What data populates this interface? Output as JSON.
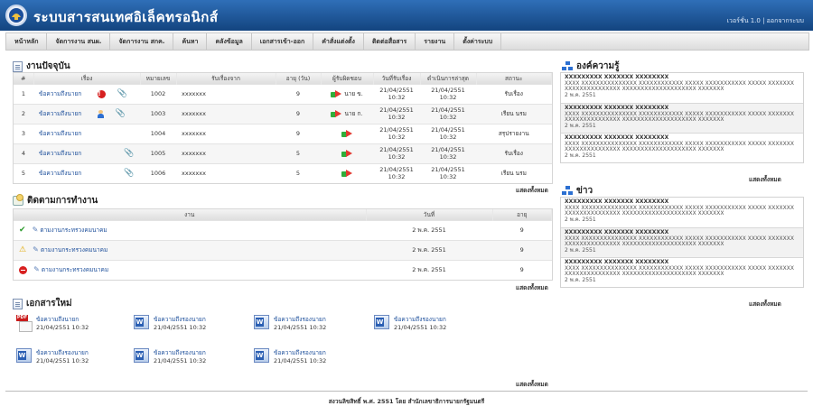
{
  "header": {
    "title": "ระบบสารสนเทศอิเล็คทรอนิกส์",
    "version_text": "เวอร์ชั่น 1.0",
    "separator": "|",
    "logout": "ออกจากระบบ"
  },
  "nav": [
    "หน้าหลัก",
    "จัดการงาน สนผ.",
    "จัดการงาน สกค.",
    "ค้นหา",
    "คลังข้อมูล",
    "เอกสารเข้า-ออก",
    "คำสั่งแต่งตั้ง",
    "ติดต่อสื่อสาร",
    "รายงาน",
    "ตั้งค่าระบบ"
  ],
  "current_work": {
    "title": "งานปัจจุบัน",
    "columns": [
      "#",
      "เรื่อง",
      "หมายเลข",
      "รับเรื่องจาก",
      "อายุ (วัน)",
      "ผู้รับผิดชอบ",
      "วันที่รับเรื่อง",
      "ดำเนินการล่าสุด",
      "สถานะ"
    ],
    "rows": [
      {
        "num": "1",
        "subject": "ข้อความถึงนายก",
        "flag": "!",
        "id": "1002",
        "from": "xxxxxxx",
        "age": "9",
        "owner": "นาย ข.",
        "received_date": "21/04/2551",
        "received_time": "10:32",
        "last_date": "21/04/2551",
        "last_time": "10:32",
        "status": "รับเรื่อง"
      },
      {
        "num": "2",
        "subject": "ข้อความถึงนายก",
        "flag": "",
        "id": "1003",
        "from": "xxxxxxx",
        "age": "9",
        "owner": "นาย ก.",
        "received_date": "21/04/2551",
        "received_time": "10:32",
        "last_date": "21/04/2551",
        "last_time": "10:32",
        "status": "เรียน นรม"
      },
      {
        "num": "3",
        "subject": "ข้อความถึงนายก",
        "flag": "",
        "id": "1004",
        "from": "xxxxxxx",
        "age": "9",
        "owner": "",
        "received_date": "21/04/2551",
        "received_time": "10:32",
        "last_date": "21/04/2551",
        "last_time": "10:32",
        "status": "สรุปรายงาน"
      },
      {
        "num": "4",
        "subject": "ข้อความถึงนายก",
        "flag": "",
        "id": "1005",
        "from": "xxxxxxx",
        "age": "5",
        "owner": "",
        "received_date": "21/04/2551",
        "received_time": "10:32",
        "last_date": "21/04/2551",
        "last_time": "10:32",
        "status": "รับเรื่อง"
      },
      {
        "num": "5",
        "subject": "ข้อความถึงนายก",
        "flag": "",
        "id": "1006",
        "from": "xxxxxxx",
        "age": "5",
        "owner": "",
        "received_date": "21/04/2551",
        "received_time": "10:32",
        "last_date": "21/04/2551",
        "last_time": "10:32",
        "status": "เรียน นรม"
      }
    ],
    "show_all": "แสดงทั้งหมด"
  },
  "followup": {
    "title": "ติดตามการทำงาน",
    "columns": [
      "งาน",
      "วันที่",
      "อายุ"
    ],
    "rows": [
      {
        "icon": "check-icon",
        "task": "ตามงานกระทรวงคมนาคม",
        "date": "2 พ.ค. 2551",
        "age": "9"
      },
      {
        "icon": "warning-icon",
        "task": "ตามงานกระทรวงคมนาคม",
        "date": "2 พ.ค. 2551",
        "age": "9"
      },
      {
        "icon": "stop-icon",
        "task": "ตามงานกระทรวงคมนาคม",
        "date": "2 พ.ค. 2551",
        "age": "9"
      }
    ],
    "show_all": "แสดงทั้งหมด"
  },
  "new_docs": {
    "title": "เอกสารใหม่",
    "items": [
      {
        "type": "pdf",
        "title": "ข้อความถึงนายก",
        "date": "21/04/2551 10:32"
      },
      {
        "type": "word",
        "title": "ข้อความถึงรองนายก",
        "date": "21/04/2551 10:32"
      },
      {
        "type": "word",
        "title": "ข้อความถึงรองนายก",
        "date": "21/04/2551 10:32"
      },
      {
        "type": "word",
        "title": "ข้อความถึงรองนายก",
        "date": "21/04/2551 10:32"
      },
      {
        "type": "word",
        "title": "ข้อความถึงรองนายก",
        "date": "21/04/2551 10:32"
      },
      {
        "type": "word",
        "title": "ข้อความถึงรองนายก",
        "date": "21/04/2551 10:32"
      },
      {
        "type": "word",
        "title": "ข้อความถึงรองนายก",
        "date": "21/04/2551 10:32"
      }
    ],
    "show_all": "แสดงทั้งหมด"
  },
  "knowledge": {
    "title": "องค์ความรู้",
    "items": [
      {
        "head": "XXXXXXXXX XXXXXXX XXXXXXXX",
        "body": "XXXX XXXXXXXXXXXXXXX XXXXXXXXXXXX XXXXX XXXXXXXXXXX XXXXX XXXXXXX XXXXXXXXXXXXXXX XXXXXXXXXXXXXXXXXXXX XXXXXXX",
        "date": "2 พ.ค. 2551"
      },
      {
        "head": "XXXXXXXXX XXXXXXX XXXXXXXX",
        "body": "XXXX XXXXXXXXXXXXXXX XXXXXXXXXXXX XXXXX XXXXXXXXXXX XXXXX XXXXXXX XXXXXXXXXXXXXXX XXXXXXXXXXXXXXXXXXXX XXXXXXX",
        "date": "2 พ.ค. 2551"
      },
      {
        "head": "XXXXXXXXX XXXXXXX XXXXXXXX",
        "body": "XXXX XXXXXXXXXXXXXXX XXXXXXXXXXXX XXXXX XXXXXXXXXXX XXXXX XXXXXXX XXXXXXXXXXXXXXX XXXXXXXXXXXXXXXXXXXX XXXXXXX",
        "date": "2 พ.ค. 2551"
      }
    ],
    "show_all": "แสดงทั้งหมด"
  },
  "news": {
    "title": "ข่าว",
    "items": [
      {
        "head": "XXXXXXXXX XXXXXXX XXXXXXXX",
        "body": "XXXX XXXXXXXXXXXXXXX XXXXXXXXXXXX XXXXX XXXXXXXXXXX XXXXX XXXXXXX XXXXXXXXXXXXXXX XXXXXXXXXXXXXXXXXXXX XXXXXXX",
        "date": "2 พ.ค. 2551"
      },
      {
        "head": "XXXXXXXXX XXXXXXX XXXXXXXX",
        "body": "XXXX XXXXXXXXXXXXXXX XXXXXXXXXXXX XXXXX XXXXXXXXXXX XXXXX XXXXXXX XXXXXXXXXXXXXXX XXXXXXXXXXXXXXXXXXXX XXXXXXX",
        "date": "2 พ.ค. 2551"
      },
      {
        "head": "XXXXXXXXX XXXXXXX XXXXXXXX",
        "body": "XXXX XXXXXXXXXXXXXXX XXXXXXXXXXXX XXXXX XXXXXXXXXXX XXXXX XXXXXXX XXXXXXXXXXXXXXX XXXXXXXXXXXXXXXXXXXX XXXXXXX",
        "date": "2 พ.ค. 2551"
      }
    ],
    "show_all": "แสดงทั้งหมด"
  },
  "footer": "สงวนลิขสิทธิ์ พ.ศ. 2551 โดย สำนักเลขาธิการนายกรัฐมนตรี"
}
